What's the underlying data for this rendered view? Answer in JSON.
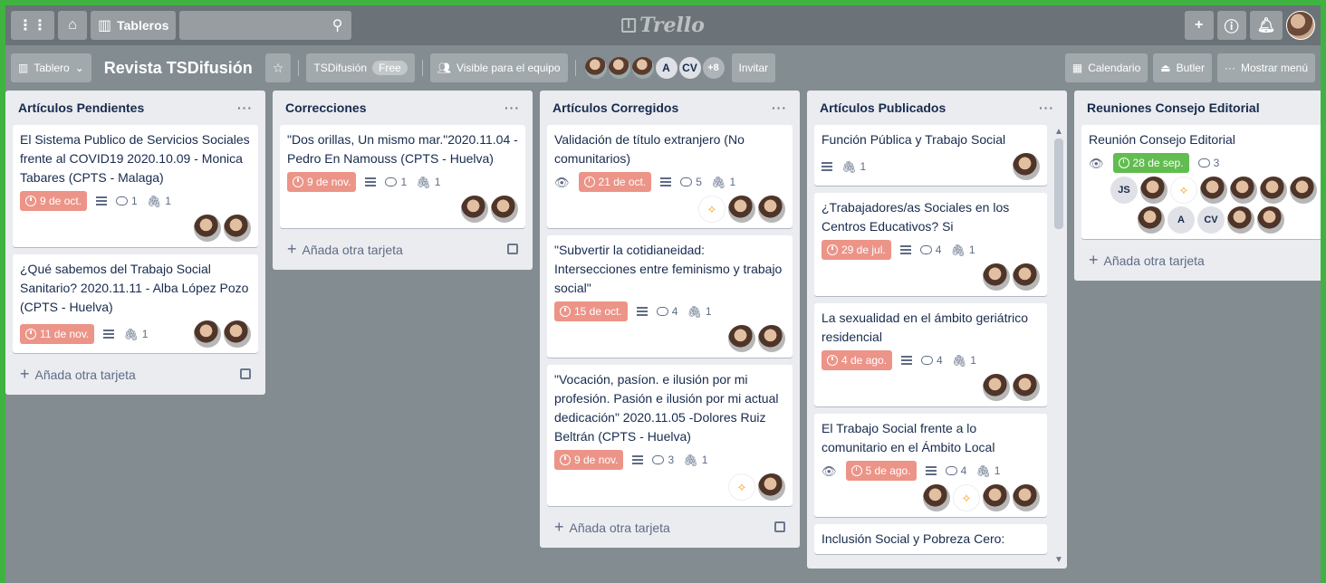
{
  "topbar": {
    "boards_label": "Tableros",
    "logo_text": "Trello"
  },
  "board": {
    "view_label": "Tablero",
    "title": "Revista TSDifusión",
    "team_label": "TSDifusión",
    "team_plan": "Free",
    "visibility_label": "Visible para el equipo",
    "members": [
      "A",
      "CV"
    ],
    "members_more": "+8",
    "invite_label": "Invitar",
    "calendar_label": "Calendario",
    "butler_label": "Butler",
    "menu_label": "Mostrar menú"
  },
  "add_card_label": "Añada otra tarjeta",
  "lists": [
    {
      "title": "Artículos Pendientes",
      "cards": [
        {
          "title": "El Sistema Publico de Servicios Sociales frente al COVID19 2020.10.09 - Monica Tabares (CPTS - Malaga)",
          "due": "9 de oct.",
          "comments": "1",
          "attachments": "1"
        },
        {
          "title": "¿Qué sabemos del Trabajo Social Sanitario? 2020.11.11 - Alba López Pozo (CPTS - Huelva)",
          "due": "11 de nov.",
          "attachments": "1"
        }
      ]
    },
    {
      "title": "Correcciones",
      "cards": [
        {
          "title": "\"Dos orillas, Un mismo mar.\"2020.11.04 - Pedro En Namouss (CPTS - Huelva)",
          "due": "9 de nov.",
          "comments": "1",
          "attachments": "1"
        }
      ]
    },
    {
      "title": "Artículos Corregidos",
      "cards": [
        {
          "title": "Validación de título extranjero (No comunitarios)",
          "due": "21 de oct.",
          "comments": "5",
          "attachments": "1"
        },
        {
          "title": "\"Subvertir la cotidianeidad: Intersecciones entre feminismo y trabajo social\"",
          "due": "15 de oct.",
          "comments": "4",
          "attachments": "1"
        },
        {
          "title": "\"Vocación, pasíon. e ilusión por mi profesión. Pasión e ilusión por mi actual dedicación\" 2020.11.05 -Dolores Ruiz Beltrán (CPTS - Huelva)",
          "due": "9 de nov.",
          "comments": "3",
          "attachments": "1"
        }
      ]
    },
    {
      "title": "Artículos Publicados",
      "cards": [
        {
          "title": "Función Pública y Trabajo Social",
          "attachments": "1"
        },
        {
          "title": "¿Trabajadores/as Sociales en los Centros Educativos? Si",
          "due": "29 de jul.",
          "comments": "4",
          "attachments": "1"
        },
        {
          "title": "La sexualidad en el ámbito geriátrico residencial",
          "due": "4 de ago.",
          "comments": "4",
          "attachments": "1"
        },
        {
          "title": "El Trabajo Social frente a lo comunitario en el Ámbito Local",
          "due": "5 de ago.",
          "comments": "4",
          "attachments": "1"
        },
        {
          "title": "Inclusión Social y Pobreza Cero:"
        }
      ]
    },
    {
      "title": "Reuniones Consejo Editorial",
      "cards": [
        {
          "title": "Reunión Consejo Editorial",
          "due": "28 de sep.",
          "comments": "3",
          "members": [
            "JS",
            "A",
            "CV"
          ]
        }
      ]
    }
  ],
  "colors": {
    "background": "#838c91",
    "frame": "#3fb33f",
    "due_red": "#ec9488",
    "due_green": "#61bd4f"
  }
}
